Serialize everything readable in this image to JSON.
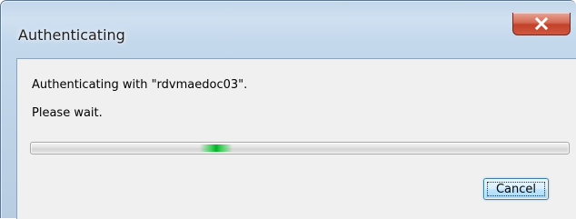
{
  "window": {
    "title": "Authenticating",
    "close_icon": "close-icon"
  },
  "content": {
    "message": "Authenticating with \"rdvmaedoc03\".",
    "wait_text": "Please wait."
  },
  "progress": {
    "mode": "marquee",
    "accent_color": "#06b025"
  },
  "buttons": {
    "cancel_label": "Cancel"
  },
  "colors": {
    "close_button": "#c7412b",
    "titlebar": "#c4d8ec",
    "client_background": "#f0f0f0"
  }
}
